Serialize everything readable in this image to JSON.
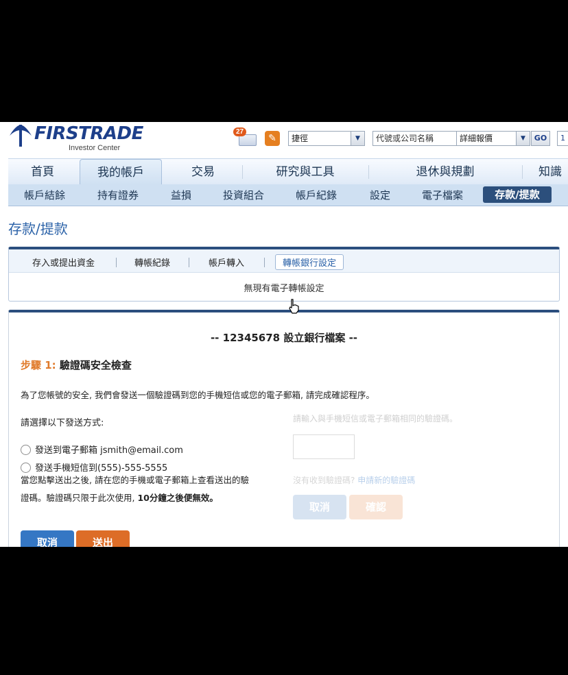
{
  "brand": {
    "name": "FIRSTRADE",
    "tagline": "Investor Center",
    "color": "#1d3f8a"
  },
  "header": {
    "message_count": "27",
    "shortcut_select": "捷徑",
    "symbol_placeholder": "代號或公司名稱",
    "quote_select": "詳細報價",
    "go_label": "GO",
    "extra_label": "1"
  },
  "main_nav": [
    "首頁",
    "我的帳戶",
    "交易",
    "研究與工具",
    "退休與規劃",
    "知識"
  ],
  "main_nav_active": "我的帳戶",
  "sub_nav": [
    "帳戶結餘",
    "持有證券",
    "益損",
    "投資組合",
    "帳戶紀錄",
    "設定",
    "電子檔案",
    "存款/提款"
  ],
  "sub_nav_active": "存款/提款",
  "page_title": "存款/提款",
  "transfer_tabs": [
    "存入或提出資金",
    "轉帳紀錄",
    "帳戶轉入",
    "轉帳銀行設定"
  ],
  "transfer_tab_active": "轉帳銀行設定",
  "no_settings": "無現有電子轉帳設定",
  "verify": {
    "account_title": "-- 12345678 設立銀行檔案 --",
    "step_no": "步驟 1:",
    "step_title": " 驗證碼安全檢查",
    "security_text": "為了您帳號的安全, 我們會發送一個驗證碼到您的手機短信或您的電子郵箱, 請完成確認程序。",
    "method_label": "請選擇以下發送方式:",
    "option_email": "發送到電子郵箱  jsmith@email.com",
    "option_sms": "發送手機短信到(555)-555-5555",
    "hint_line1": "當您點擊送出之後, 請在您的手機或電子郵箱上查看送出的驗",
    "hint_line2": "證碼。驗證碼只限于此次使用, ",
    "hint_bold": "10分鐘之後便無效。",
    "cancel_label": "取消",
    "send_label": "送出",
    "code_prompt": "請輸入與手機短信或電子郵箱相同的驗證碼。",
    "resend_question": "沒有收到驗證碼?",
    "resend_link": "申請新的驗證碼",
    "cancel2_label": "取消",
    "confirm_label": "確認"
  }
}
